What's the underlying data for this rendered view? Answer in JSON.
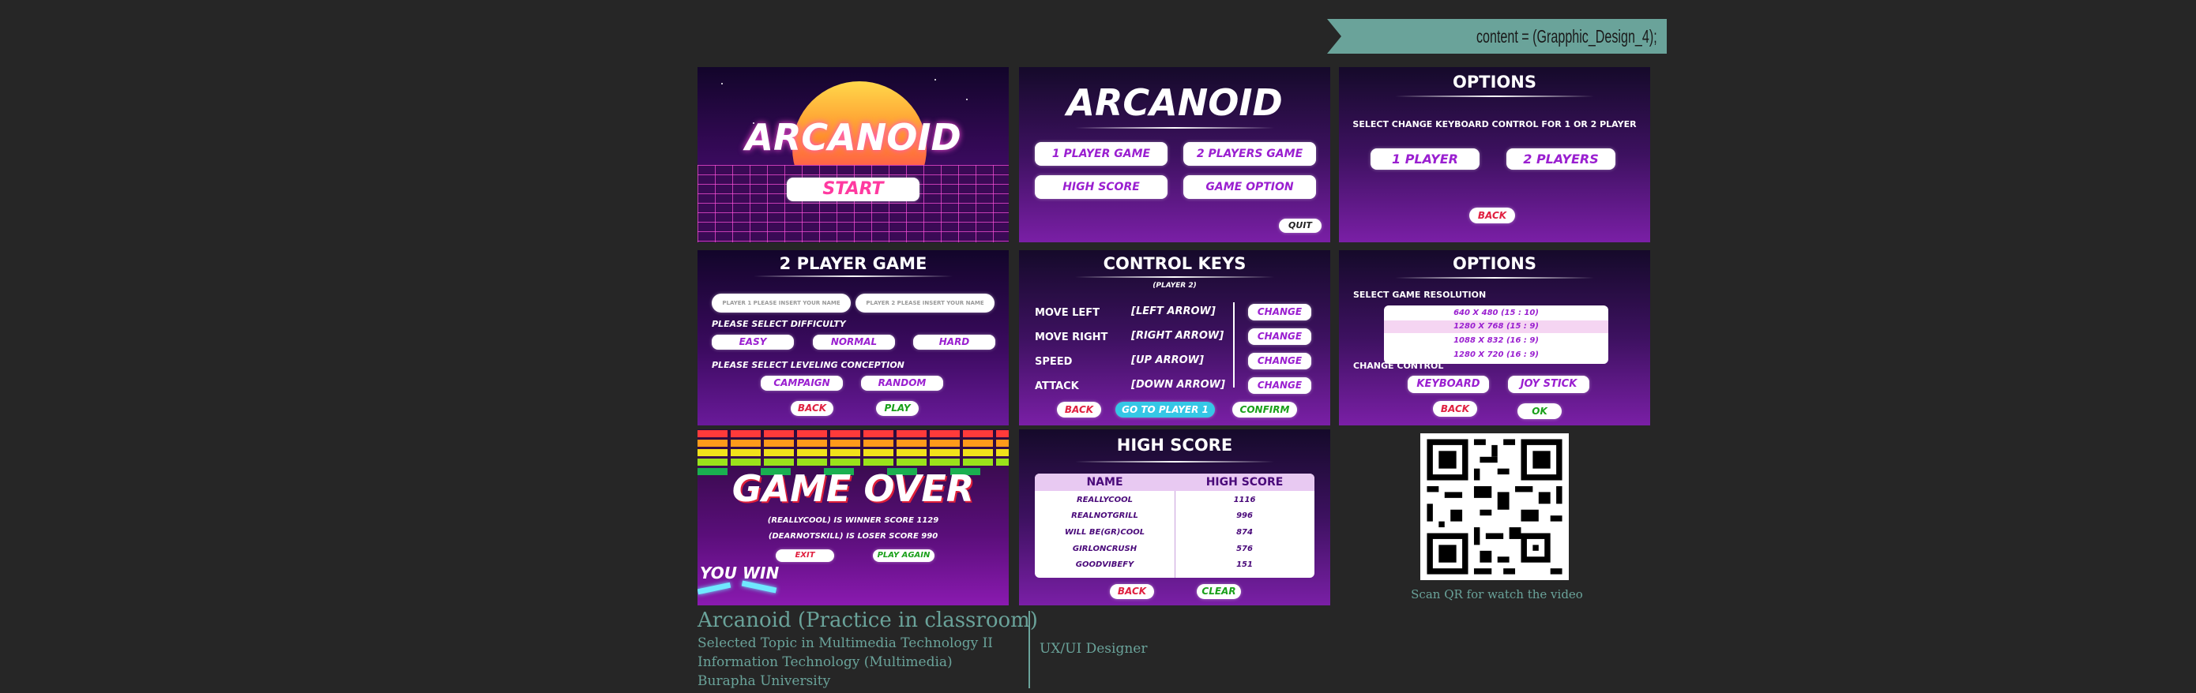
{
  "tag": "content = (Grapphic_Design_4);",
  "p1": {
    "title": "ARCANOID",
    "start": "START"
  },
  "p2": {
    "title": "ARCANOID",
    "b1": "1 PLAYER GAME",
    "b2": "2 PLAYERS GAME",
    "b3": "HIGH SCORE",
    "b4": "GAME OPTION",
    "quit": "QUIT"
  },
  "p3": {
    "title": "OPTIONS",
    "sub": "SELECT CHANGE KEYBOARD CONTROL FOR 1 OR 2 PLAYER",
    "b1": "1 PLAYER",
    "b2": "2 PLAYERS",
    "back": "BACK"
  },
  "p4": {
    "title": "2   PLAYER GAME",
    "in1": "PLAYER 1 PLEASE INSERT YOUR NAME",
    "in2": "PLAYER 2 PLEASE INSERT YOUR NAME",
    "diff": "PLEASE SELECT DIFFICULTY",
    "easy": "EASY",
    "normal": "NORMAL",
    "hard": "HARD",
    "lvl": "PLEASE SELECT LEVELING CONCEPTION",
    "campaign": "CAMPAIGN",
    "random": "RANDOM",
    "back": "BACK",
    "play": "PLAY"
  },
  "p5": {
    "title": "CONTROL KEYS",
    "player": "(PLAYER 2)",
    "rows": [
      {
        "a": "MOVE LEFT",
        "k": "[LEFT ARROW]"
      },
      {
        "a": "MOVE RIGHT",
        "k": "[RIGHT ARROW]"
      },
      {
        "a": "SPEED",
        "k": "[UP ARROW]"
      },
      {
        "a": "ATTACK",
        "k": "[DOWN ARROW]"
      }
    ],
    "change": "CHANGE",
    "back": "BACK",
    "goto": "GO TO PLAYER 1",
    "confirm": "CONFIRM"
  },
  "p6": {
    "title": "OPTIONS",
    "sub": "SELECT GAME RESOLUTION",
    "res": [
      "640 X 480 (15 : 10)",
      "1280 X 768 (15 : 9)",
      "1088 X 832 (16 : 9)",
      "1280 X 720 (16 : 9)"
    ],
    "cc": "CHANGE CONTROL",
    "kb": "KEYBOARD",
    "js": "JOY STICK",
    "back": "BACK",
    "ok": "OK"
  },
  "p7": {
    "title": "GAME OVER",
    "l1": "(REALLYCOOL) IS WINNER SCORE 1129",
    "l2": "(DEARNOTSKILL) IS LOSER SCORE 990",
    "exit": "EXIT",
    "again": "PLAY AGAIN",
    "win": "YOU WIN"
  },
  "p8": {
    "title": "HIGH SCORE",
    "h1": "NAME",
    "h2": "HIGH SCORE",
    "rows": [
      {
        "n": "REALLYCOOL",
        "s": "1116"
      },
      {
        "n": "REALNOTGRILL",
        "s": "996"
      },
      {
        "n": "WILL BE(GR)COOL",
        "s": "874"
      },
      {
        "n": "GIRLONCRUSH",
        "s": "576"
      },
      {
        "n": "GOODVIBEFY",
        "s": "151"
      }
    ],
    "back": "BACK",
    "clear": "CLEAR"
  },
  "qr_caption": "Scan QR for watch the video",
  "footer": {
    "title": "Arcanoid (Practice in classroom)",
    "l1": "Selected Topic in Multimedia Technology II",
    "l2": "Information Technology (Multimedia)",
    "l3": "Burapha University",
    "role": "UX/UI Designer"
  },
  "colors": {
    "bg": "#262626",
    "teal": "#6aa39a",
    "purple": "#9a1fd0",
    "red": "#e02040",
    "green": "#1aa01a"
  }
}
